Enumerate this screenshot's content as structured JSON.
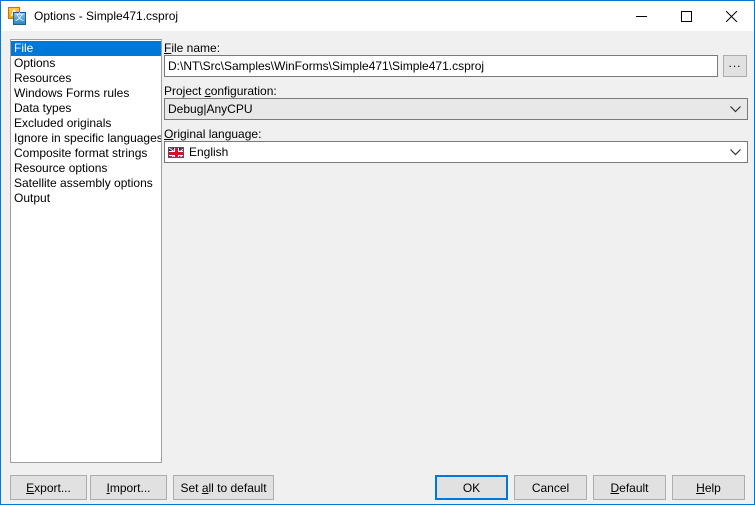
{
  "window": {
    "title": "Options - Simple471.csproj",
    "icon": "translation-icon",
    "accent_color": "#0078d7",
    "background_color": "#f0f0f0"
  },
  "titlebar_buttons": {
    "minimize": "minimize-icon",
    "maximize": "maximize-icon",
    "close": "close-icon"
  },
  "sidebar": {
    "items": [
      {
        "label": "File",
        "selected": true
      },
      {
        "label": "Options",
        "selected": false
      },
      {
        "label": "Resources",
        "selected": false
      },
      {
        "label": "Windows Forms rules",
        "selected": false
      },
      {
        "label": "Data types",
        "selected": false
      },
      {
        "label": "Excluded originals",
        "selected": false
      },
      {
        "label": "Ignore in specific languages",
        "selected": false
      },
      {
        "label": "Composite format strings",
        "selected": false
      },
      {
        "label": "Resource options",
        "selected": false
      },
      {
        "label": "Satellite assembly options",
        "selected": false
      },
      {
        "label": "Output",
        "selected": false
      }
    ]
  },
  "pane": {
    "file_name": {
      "label_pre": "F",
      "label_accel": "",
      "label": "File name:",
      "value": "D:\\NT\\Src\\Samples\\WinForms\\Simple471\\Simple471.csproj",
      "browse_label": "..."
    },
    "project_configuration": {
      "label": "Project configuration:",
      "value": "Debug|AnyCPU"
    },
    "original_language": {
      "label": "Original language:",
      "value": "English",
      "flag": "uk-flag-icon"
    }
  },
  "buttons": {
    "export": "Export...",
    "import": "Import...",
    "set_all_to_default": "Set all to default",
    "ok": "OK",
    "cancel": "Cancel",
    "default": "Default",
    "help": "Help"
  }
}
